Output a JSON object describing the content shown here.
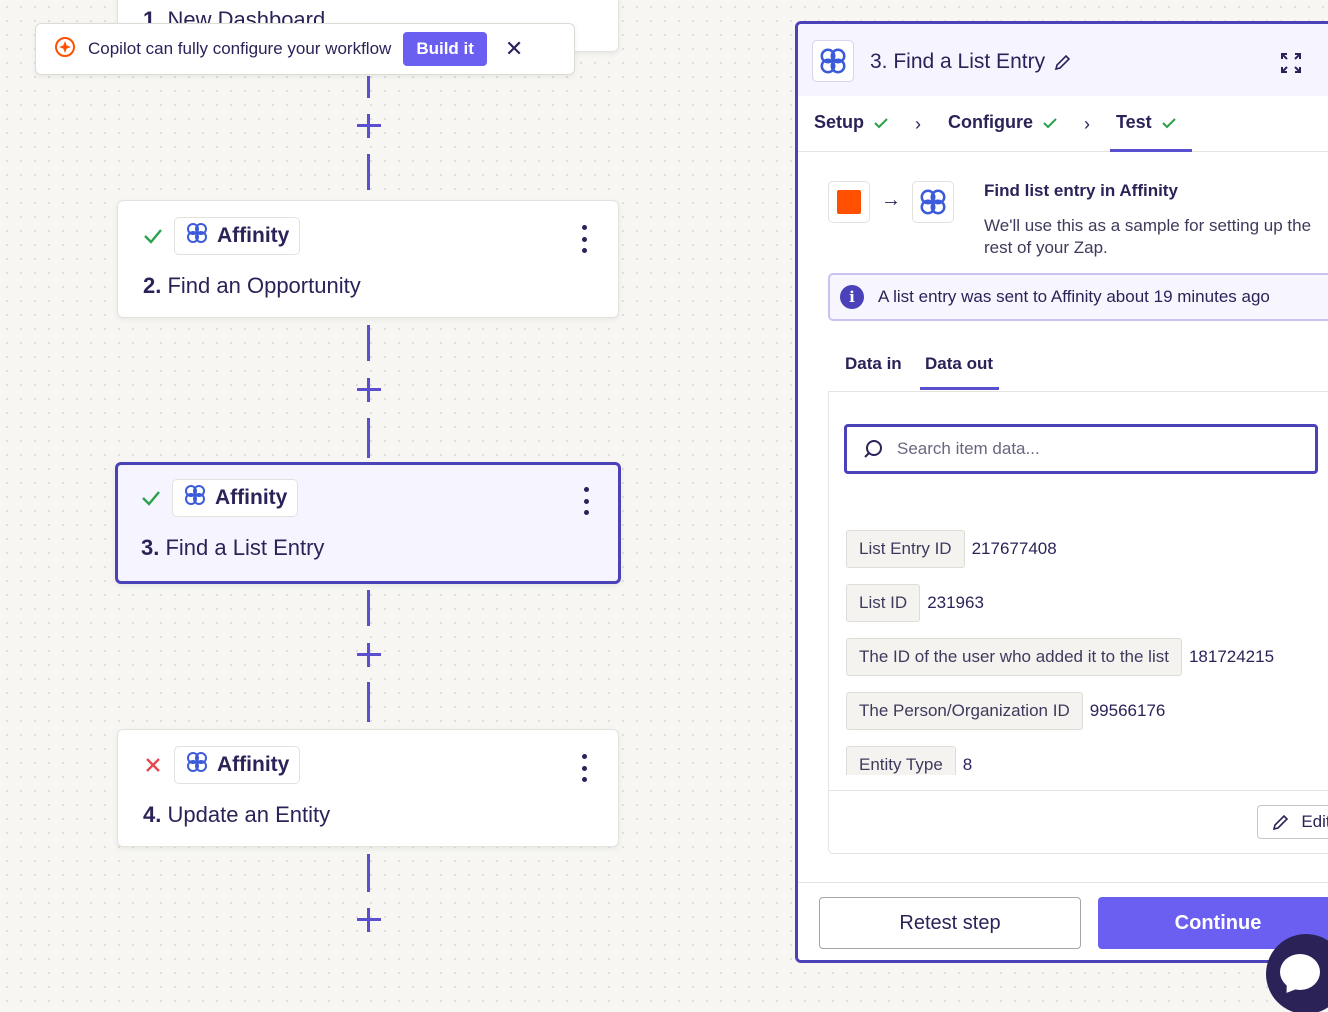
{
  "canvas": {
    "cards": [
      {
        "number": "1.",
        "title": "New Dashboard"
      },
      {
        "status": "success",
        "app": "Affinity",
        "number": "2.",
        "title": "Find an Opportunity"
      },
      {
        "status": "success",
        "app": "Affinity",
        "number": "3.",
        "title": "Find a List Entry",
        "selected": true
      },
      {
        "status": "error",
        "app": "Affinity",
        "number": "4.",
        "title": "Update an Entity"
      }
    ]
  },
  "copilot": {
    "text": "Copilot can fully configure your workflow",
    "build_label": "Build it",
    "close_label": "✕"
  },
  "panel": {
    "title": "3. Find a List Entry",
    "steps": [
      {
        "label": "Setup",
        "done": true
      },
      {
        "label": "Configure",
        "done": true
      },
      {
        "label": "Test",
        "done": true,
        "active": true
      }
    ],
    "find_title": "Find list entry in Affinity",
    "find_desc": "We'll use this as a sample for setting up the rest of your Zap.",
    "info_text": "A list entry was sent to Affinity about 19 minutes ago",
    "data_tabs": [
      "Data in",
      "Data out"
    ],
    "search_placeholder": "Search item data...",
    "fields": [
      {
        "label": "List Entry ID",
        "value": "217677408"
      },
      {
        "label": "List ID",
        "value": "231963"
      },
      {
        "label": "The ID of the user who added it to the list",
        "value": "181724215"
      },
      {
        "label": "The Person/Organization ID",
        "value": "99566176"
      },
      {
        "label": "Entity Type",
        "value": "8"
      }
    ],
    "edit_label": "Edit",
    "retest_label": "Retest step",
    "continue_label": "Continue"
  },
  "colors": {
    "accent": "#6a5ff0",
    "accent_dark": "#4b41b8",
    "success": "#2aa14b",
    "error": "#e5484d",
    "zapier_orange": "#ff4f00",
    "text": "#2b2358"
  }
}
